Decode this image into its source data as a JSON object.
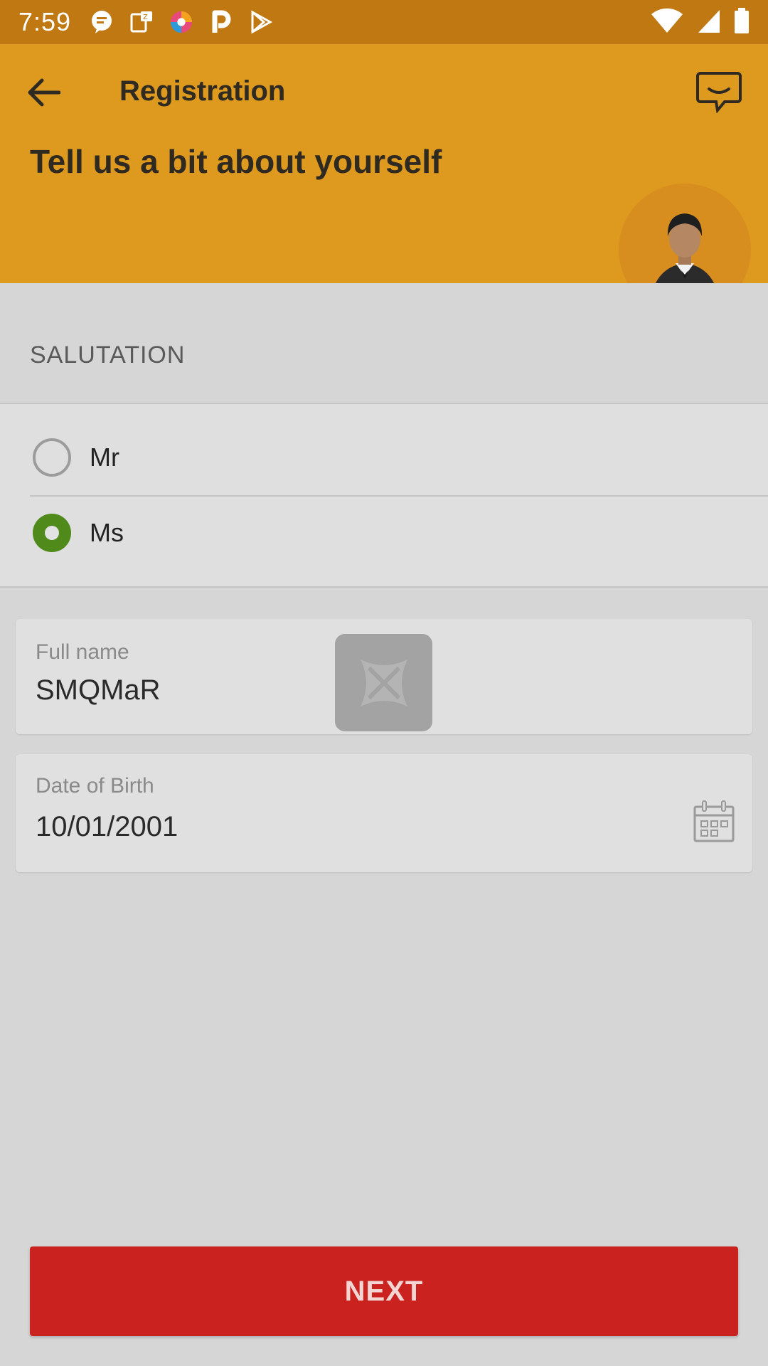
{
  "status_bar": {
    "time": "7:59",
    "icons": [
      "messages-icon",
      "notes-icon",
      "browser-icon",
      "parking-icon",
      "play-store-icon"
    ],
    "right_icons": [
      "wifi-icon",
      "signal-icon",
      "battery-icon"
    ]
  },
  "header": {
    "title": "Registration",
    "subtitle": "Tell us a bit about yourself",
    "back_icon": "arrow-back-icon",
    "chat_icon": "chat-icon"
  },
  "salutation": {
    "label": "SALUTATION",
    "options": [
      {
        "label": "Mr",
        "selected": false
      },
      {
        "label": "Ms",
        "selected": true
      }
    ]
  },
  "form": {
    "full_name": {
      "label": "Full name",
      "value": "SMQMaR"
    },
    "dob": {
      "label": "Date of Birth",
      "value": "10/01/2001",
      "icon": "calendar-icon"
    }
  },
  "next_button": {
    "label": "NEXT"
  },
  "colors": {
    "status_bar": "#c07812",
    "header": "#de9a1e",
    "radio_selected": "#4f8a1b",
    "next": "#c9221f"
  }
}
